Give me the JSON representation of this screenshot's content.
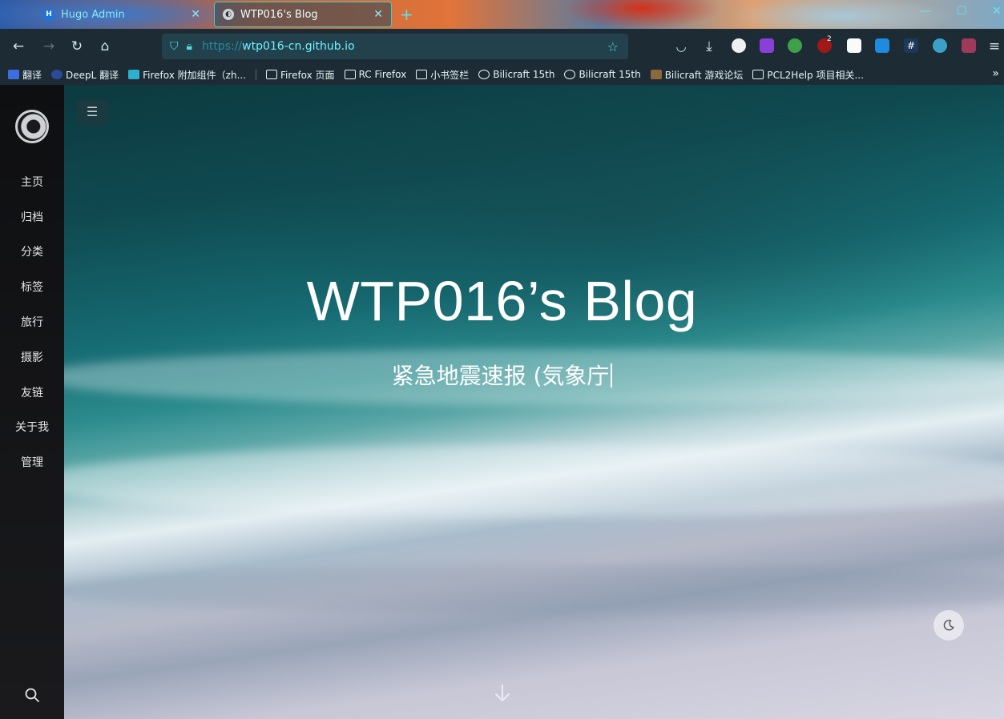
{
  "browser": {
    "tabs": [
      {
        "label": "Hugo Admin",
        "favicon": "H"
      },
      {
        "label": "WTP016's Blog",
        "favicon": ""
      }
    ],
    "url": {
      "protocol": "https://",
      "host": "wtp016-cn.github.io"
    },
    "bookmarks": [
      {
        "label": "翻译",
        "icon": "google-translate-icon"
      },
      {
        "label": "DeepL 翻译",
        "icon": "deepl-icon"
      },
      {
        "label": "Firefox 附加组件（zh...",
        "icon": "firefox-addons-icon"
      },
      {
        "label": "Firefox 页面",
        "icon": "folder-icon"
      },
      {
        "label": "RC Firefox",
        "icon": "folder-icon"
      },
      {
        "label": "小书签栏",
        "icon": "folder-icon"
      },
      {
        "label": "Bilicraft 15th",
        "icon": "globe-icon"
      },
      {
        "label": "Bilicraft 15th",
        "icon": "globe-icon"
      },
      {
        "label": "Bilicraft 游戏论坛",
        "icon": "minecraft-icon"
      },
      {
        "label": "PCL2Help 项目相关...",
        "icon": "folder-icon"
      }
    ],
    "extension_badge": "2"
  },
  "sidebar": {
    "items": [
      {
        "label": "主页"
      },
      {
        "label": "归档"
      },
      {
        "label": "分类"
      },
      {
        "label": "标签"
      },
      {
        "label": "旅行"
      },
      {
        "label": "摄影"
      },
      {
        "label": "友链"
      },
      {
        "label": "关于我"
      },
      {
        "label": "管理"
      }
    ]
  },
  "hero": {
    "title": "WTP016’s Blog",
    "subtitle": "紧急地震速报 (気象庁"
  },
  "colors": {
    "accent": "#35d3d3",
    "sidebar_bg": "#111214",
    "title_text": "#ffffff"
  }
}
